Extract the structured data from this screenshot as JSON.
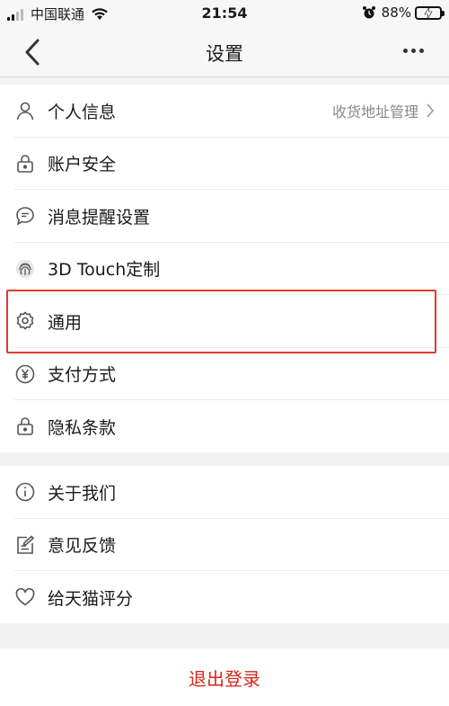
{
  "status_bar": {
    "carrier": "中国联通",
    "time": "21:54",
    "battery": "88%"
  },
  "nav": {
    "title": "设置",
    "back_icon": "chevron-left-icon",
    "more_icon": "more-dots-icon"
  },
  "groups": [
    {
      "items": [
        {
          "label": "个人信息",
          "icon": "user-icon",
          "detail": "收货地址管理",
          "has_arrow": true
        },
        {
          "label": "账户安全",
          "icon": "lock-icon"
        },
        {
          "label": "消息提醒设置",
          "icon": "message-icon"
        },
        {
          "label": "3D Touch定制",
          "icon": "fingerprint-icon"
        },
        {
          "label": "通用",
          "icon": "gear-icon",
          "highlighted": true
        },
        {
          "label": "支付方式",
          "icon": "yen-icon"
        },
        {
          "label": "隐私条款",
          "icon": "lock-icon"
        }
      ]
    },
    {
      "items": [
        {
          "label": "关于我们",
          "icon": "info-icon"
        },
        {
          "label": "意见反馈",
          "icon": "feedback-icon"
        },
        {
          "label": "给天猫评分",
          "icon": "heart-icon"
        }
      ]
    }
  ],
  "logout": {
    "label": "退出登录"
  },
  "colors": {
    "accent_red": "#d5261a",
    "highlight_border": "#e23a2f",
    "battery_green": "#3ecb4b"
  }
}
